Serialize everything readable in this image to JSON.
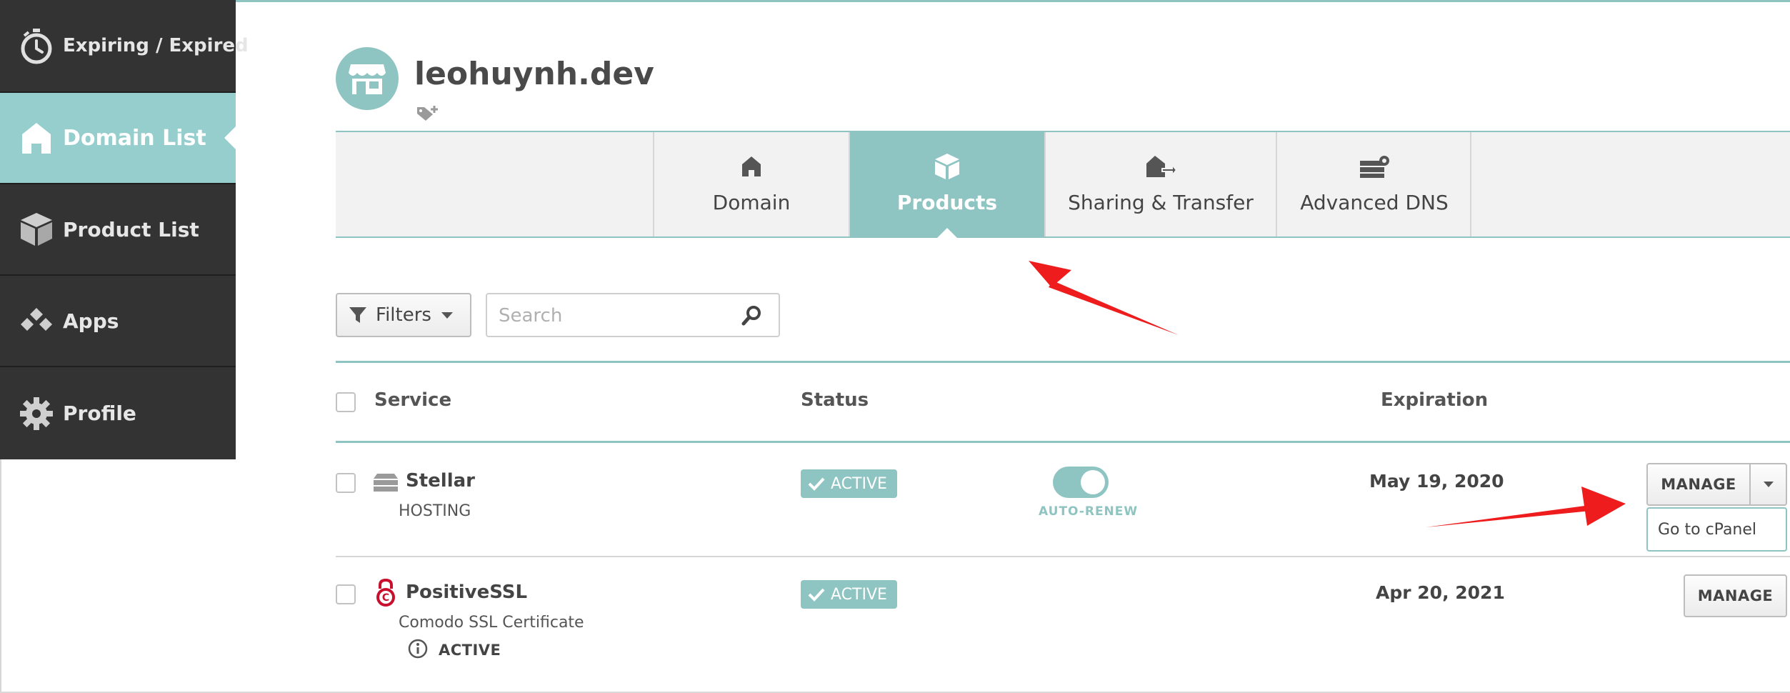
{
  "sidebar": {
    "items": [
      {
        "label": "Expiring / Expired",
        "icon": "stopwatch-icon",
        "active": false
      },
      {
        "label": "Domain List",
        "icon": "home-icon",
        "active": true
      },
      {
        "label": "Product List",
        "icon": "box-icon",
        "active": false
      },
      {
        "label": "Apps",
        "icon": "apps-icon",
        "active": false
      },
      {
        "label": "Profile",
        "icon": "gear-icon",
        "active": false
      }
    ]
  },
  "header": {
    "domain": "leohuynh.dev",
    "logo_icon": "storefront-icon",
    "tag_icon": "tag-plus-icon"
  },
  "tabs": [
    {
      "label": "Domain",
      "icon": "home-icon",
      "active": false
    },
    {
      "label": "Products",
      "icon": "box-icon",
      "active": true
    },
    {
      "label": "Sharing & Transfer",
      "icon": "house-transfer-icon",
      "active": false
    },
    {
      "label": "Advanced DNS",
      "icon": "server-gear-icon",
      "active": false
    }
  ],
  "toolbar": {
    "filters_label": "Filters",
    "search_placeholder": "Search"
  },
  "table": {
    "columns": {
      "service": "Service",
      "status": "Status",
      "expiration": "Expiration"
    },
    "rows": [
      {
        "name": "Stellar",
        "type": "HOSTING",
        "icon": "server-icon",
        "status": "ACTIVE",
        "auto_renew_label": "AUTO-RENEW",
        "auto_renew_on": true,
        "expiration": "May 19, 2020",
        "action": "MANAGE",
        "dropdown_item": "Go to cPanel"
      },
      {
        "name": "PositiveSSL",
        "type": "Comodo SSL Certificate",
        "icon": "ssl-lock-icon",
        "status": "ACTIVE",
        "info_status": "ACTIVE",
        "expiration": "Apr 20, 2021",
        "action": "MANAGE"
      }
    ]
  },
  "colors": {
    "sidebar_bg": "#333333",
    "accent_teal": "#8ec4c1",
    "annotation_red": "#ee1c1c",
    "ssl_red": "#c8102e"
  }
}
